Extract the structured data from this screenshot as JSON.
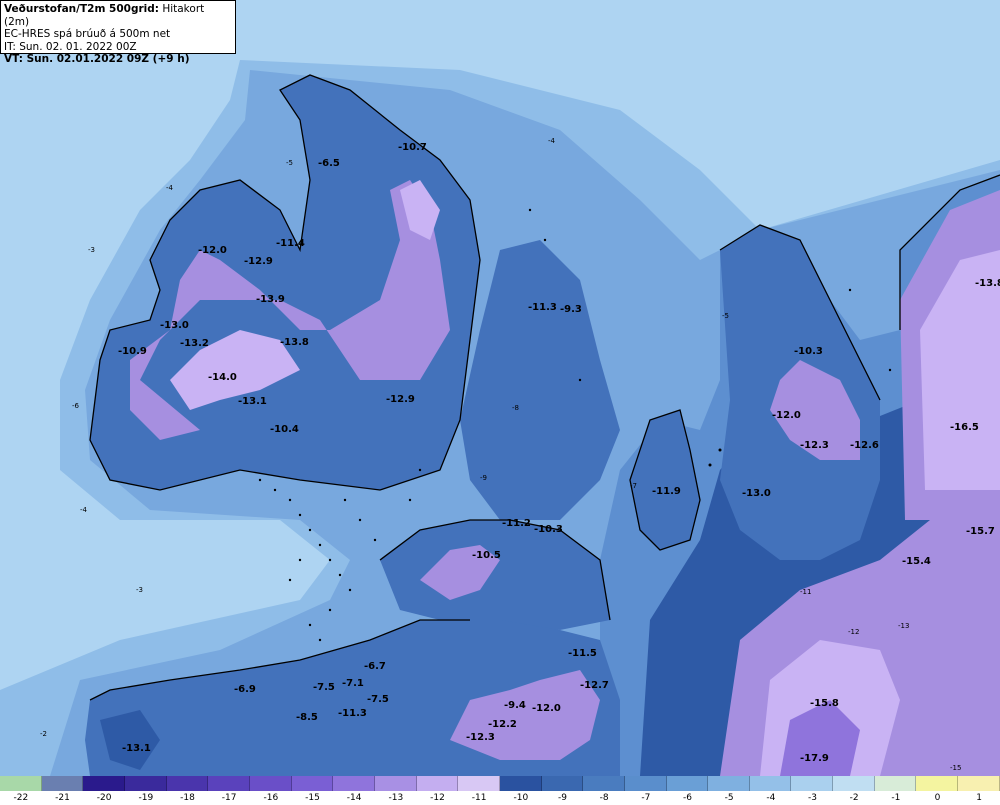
{
  "header": {
    "title_bold": "Veðurstofan/T2m 500grid:",
    "title_rest": " Hitakort (2m)",
    "line2": "EC-HRES spá brúuð á 500m net",
    "line3": "IT: Sun. 02. 01. 2022 00Z",
    "line4": "VT: Sun. 02.01.2022 09Z (+9 h)"
  },
  "legend": {
    "ticks": [
      "-22",
      "-21",
      "-20",
      "-19",
      "-18",
      "-17",
      "-16",
      "-15",
      "-14",
      "-13",
      "-12",
      "-11",
      "-10",
      "-9",
      "-8",
      "-7",
      "-6",
      "-5",
      "-4",
      "-3",
      "-2",
      "-1",
      "0",
      "1"
    ],
    "colors": [
      "#a8d8a8",
      "#6a7fb0",
      "#2a1a8c",
      "#3a2a9c",
      "#4a35ac",
      "#5a42bc",
      "#6a4fc8",
      "#7a5fd4",
      "#8f74dc",
      "#a890e4",
      "#c4aef0",
      "#d8c8f4",
      "#2a52a0",
      "#3a68b0",
      "#4a7cbf",
      "#5a8ecc",
      "#6a9fd6",
      "#7fb0e0",
      "#94c0e8",
      "#aad0ee",
      "#c0def2",
      "#d8ecd8",
      "#f4f4a0",
      "#f8f0b0"
    ]
  },
  "map": {
    "colors": {
      "sea_light": "#aed4f2",
      "sea_mid": "#8fbde8",
      "sea_deep": "#78a8de",
      "land_warm": "#5d8fd0",
      "land_mid": "#4372bb",
      "land_cold": "#2e5aa6",
      "mountain": "#a68fe0",
      "mountain_peak": "#c9b3f4",
      "coast": "#000000"
    },
    "temperature_labels": [
      {
        "text": "-10.7"
      },
      {
        "text": "-6.5"
      },
      {
        "text": "-12.0"
      },
      {
        "text": "-12.9"
      },
      {
        "text": "-11.4"
      },
      {
        "text": "-13.9"
      },
      {
        "text": "-13.0"
      },
      {
        "text": "-13.2"
      },
      {
        "text": "-13.8"
      },
      {
        "text": "-10.9"
      },
      {
        "text": "-14.0"
      },
      {
        "text": "-13.1"
      },
      {
        "text": "-10.4"
      },
      {
        "text": "-12.9"
      },
      {
        "text": "-11.3"
      },
      {
        "text": "-9.3"
      },
      {
        "text": "-10.3"
      },
      {
        "text": "-12.0"
      },
      {
        "text": "-12.3"
      },
      {
        "text": "-12.6"
      },
      {
        "text": "-13.8"
      },
      {
        "text": "-16.5"
      },
      {
        "text": "-11.9"
      },
      {
        "text": "-13.0"
      },
      {
        "text": "-11.2"
      },
      {
        "text": "-10.3"
      },
      {
        "text": "-10.5"
      },
      {
        "text": "-15.7"
      },
      {
        "text": "-15.4"
      },
      {
        "text": "-11.5"
      },
      {
        "text": "-12.7"
      },
      {
        "text": "-6.7"
      },
      {
        "text": "-6.9"
      },
      {
        "text": "-7.5"
      },
      {
        "text": "-7.1"
      },
      {
        "text": "-7.5"
      },
      {
        "text": "-8.5"
      },
      {
        "text": "-11.3"
      },
      {
        "text": "-9.4"
      },
      {
        "text": "-12.0"
      },
      {
        "text": "-12.2"
      },
      {
        "text": "-12.3"
      },
      {
        "text": "-15.8"
      },
      {
        "text": "-17.9"
      },
      {
        "text": "-13.1"
      }
    ],
    "isoline_labels": [
      "-3",
      "-4",
      "-5",
      "-4",
      "-3",
      "-2",
      "-4",
      "-5",
      "-6",
      "-7",
      "-8",
      "-9",
      "-11",
      "-12",
      "-13",
      "-15"
    ]
  }
}
